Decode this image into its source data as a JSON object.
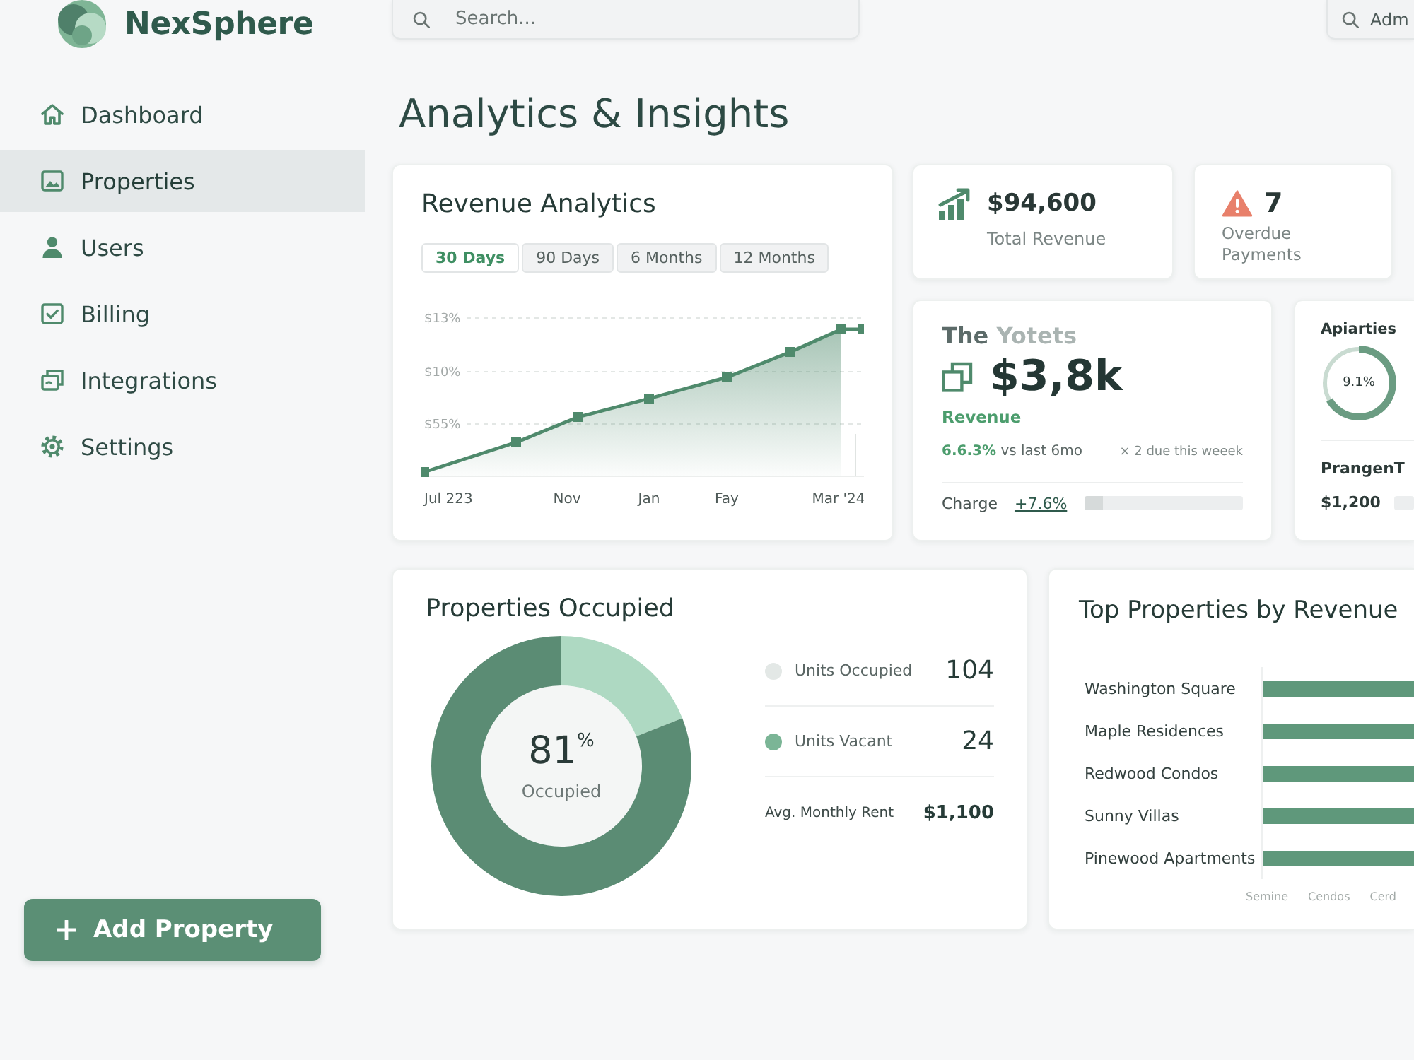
{
  "sidebar": {
    "brand": "NexSphere",
    "items": [
      {
        "label": "Dashboard",
        "selected": false
      },
      {
        "label": "Properties",
        "selected": true
      },
      {
        "label": "Users",
        "selected": false
      },
      {
        "label": "Billing",
        "selected": false
      },
      {
        "label": "Integrations",
        "selected": false
      },
      {
        "label": "Settings",
        "selected": false
      }
    ],
    "add_button": "Add Property"
  },
  "top_bar": {
    "search": {
      "placeholder": "Search..."
    },
    "account_search": {
      "value": "Adm"
    }
  },
  "page_title": "Analytics & Insights",
  "revenue_analytics": {
    "title": "Revenue Analytics",
    "tabs": [
      {
        "label": "30 Days",
        "selected": true
      },
      {
        "label": "90 Days",
        "selected": false
      },
      {
        "label": "6 Months",
        "selected": false
      },
      {
        "label": "12 Months",
        "selected": false
      }
    ],
    "y_axis_labels": [
      "$13%",
      "$10%",
      "$55%"
    ],
    "x_axis_labels": [
      "Jul 223",
      "Nov",
      "Jan",
      "Fay",
      "Mar '24"
    ]
  },
  "stats": [
    {
      "kind": "growth",
      "value": "$94,600",
      "label": "Total Revenue"
    },
    {
      "kind": "warning",
      "value": "7",
      "label": "Overdue Payments"
    }
  ],
  "summary": {
    "title": "The",
    "title_faded": "Yotets",
    "value": "$3,8k",
    "label": "Revenue",
    "change": "6.6.3%",
    "change_note": "vs last 6mo",
    "due_note": "× 2 due this weeek",
    "footer_label": "Charge",
    "footer_value": "+7.6%",
    "level": 0.12
  },
  "side_card": {
    "title": "Apiarties",
    "ring_label": "9.1%",
    "subtitle": "PrangenT",
    "value": "$1,200"
  },
  "occupancy": {
    "title": "Properties Occupied",
    "chart_data": [
      {
        "type": "donut",
        "categories": [
          null,
          null
        ],
        "values": [
          19,
          81
        ],
        "colors": [
          "#aed9c2",
          "#5b8c74"
        ]
      }
    ],
    "center_value": "81$^{%}$",
    "center_label": "Occupied",
    "legend": [
      {
        "kind": "dot",
        "label": "Units Occupied",
        "value": "104",
        "color": "#e3e8e6"
      },
      {
        "kind": "dot",
        "label": "Units Vacant",
        "value": "24",
        "color": "#7bb596"
      },
      {
        "kind": "plain",
        "label": "Avg. Monthly Rent",
        "value": "$1,100"
      }
    ]
  },
  "top_properties": {
    "title": "Top Properties by Revenue",
    "properties": [
      "Washington Square",
      "Maple Residences",
      "Redwood Condos",
      "Sunny Villas",
      "Pinewood Apartments"
    ],
    "axis_labels": [
      "Semine",
      "Cendos",
      "Cerd"
    ]
  }
}
